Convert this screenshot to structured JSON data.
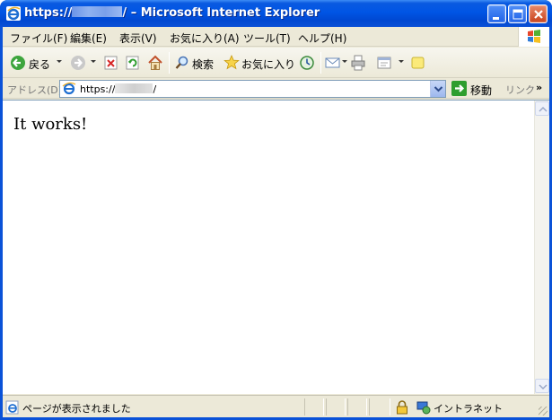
{
  "window": {
    "title_prefix": "https://",
    "title_suffix": "/ – Microsoft Internet Explorer"
  },
  "menubar": {
    "items": [
      "ファイル(F)",
      "編集(E)",
      "表示(V)",
      "お気に入り(A)",
      "ツール(T)",
      "ヘルプ(H)"
    ]
  },
  "toolbar": {
    "back_label": "戻る",
    "search_label": "検索",
    "favorites_label": "お気に入り"
  },
  "addressbar": {
    "label": "アドレス(D)",
    "url_prefix": "https://",
    "url_suffix": "/",
    "go_label": "移動",
    "links_label": "リンク",
    "more_glyph": "»"
  },
  "content": {
    "text": "It works!"
  },
  "statusbar": {
    "text": "ページが表示されました",
    "zone": "イントラネット"
  },
  "colors": {
    "titlebar": "#0055e5",
    "chrome": "#ece9d8",
    "go_green": "#2e9e2e"
  }
}
